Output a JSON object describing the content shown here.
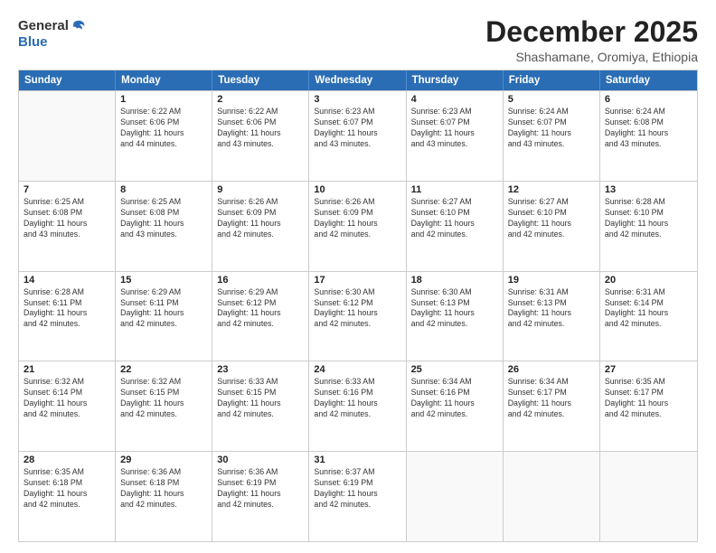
{
  "logo": {
    "general": "General",
    "blue": "Blue"
  },
  "title": "December 2025",
  "subtitle": "Shashamane, Oromiya, Ethiopia",
  "header_days": [
    "Sunday",
    "Monday",
    "Tuesday",
    "Wednesday",
    "Thursday",
    "Friday",
    "Saturday"
  ],
  "weeks": [
    [
      {
        "day": "",
        "info": ""
      },
      {
        "day": "1",
        "info": "Sunrise: 6:22 AM\nSunset: 6:06 PM\nDaylight: 11 hours\nand 44 minutes."
      },
      {
        "day": "2",
        "info": "Sunrise: 6:22 AM\nSunset: 6:06 PM\nDaylight: 11 hours\nand 43 minutes."
      },
      {
        "day": "3",
        "info": "Sunrise: 6:23 AM\nSunset: 6:07 PM\nDaylight: 11 hours\nand 43 minutes."
      },
      {
        "day": "4",
        "info": "Sunrise: 6:23 AM\nSunset: 6:07 PM\nDaylight: 11 hours\nand 43 minutes."
      },
      {
        "day": "5",
        "info": "Sunrise: 6:24 AM\nSunset: 6:07 PM\nDaylight: 11 hours\nand 43 minutes."
      },
      {
        "day": "6",
        "info": "Sunrise: 6:24 AM\nSunset: 6:08 PM\nDaylight: 11 hours\nand 43 minutes."
      }
    ],
    [
      {
        "day": "7",
        "info": "Sunrise: 6:25 AM\nSunset: 6:08 PM\nDaylight: 11 hours\nand 43 minutes."
      },
      {
        "day": "8",
        "info": "Sunrise: 6:25 AM\nSunset: 6:08 PM\nDaylight: 11 hours\nand 43 minutes."
      },
      {
        "day": "9",
        "info": "Sunrise: 6:26 AM\nSunset: 6:09 PM\nDaylight: 11 hours\nand 42 minutes."
      },
      {
        "day": "10",
        "info": "Sunrise: 6:26 AM\nSunset: 6:09 PM\nDaylight: 11 hours\nand 42 minutes."
      },
      {
        "day": "11",
        "info": "Sunrise: 6:27 AM\nSunset: 6:10 PM\nDaylight: 11 hours\nand 42 minutes."
      },
      {
        "day": "12",
        "info": "Sunrise: 6:27 AM\nSunset: 6:10 PM\nDaylight: 11 hours\nand 42 minutes."
      },
      {
        "day": "13",
        "info": "Sunrise: 6:28 AM\nSunset: 6:10 PM\nDaylight: 11 hours\nand 42 minutes."
      }
    ],
    [
      {
        "day": "14",
        "info": "Sunrise: 6:28 AM\nSunset: 6:11 PM\nDaylight: 11 hours\nand 42 minutes."
      },
      {
        "day": "15",
        "info": "Sunrise: 6:29 AM\nSunset: 6:11 PM\nDaylight: 11 hours\nand 42 minutes."
      },
      {
        "day": "16",
        "info": "Sunrise: 6:29 AM\nSunset: 6:12 PM\nDaylight: 11 hours\nand 42 minutes."
      },
      {
        "day": "17",
        "info": "Sunrise: 6:30 AM\nSunset: 6:12 PM\nDaylight: 11 hours\nand 42 minutes."
      },
      {
        "day": "18",
        "info": "Sunrise: 6:30 AM\nSunset: 6:13 PM\nDaylight: 11 hours\nand 42 minutes."
      },
      {
        "day": "19",
        "info": "Sunrise: 6:31 AM\nSunset: 6:13 PM\nDaylight: 11 hours\nand 42 minutes."
      },
      {
        "day": "20",
        "info": "Sunrise: 6:31 AM\nSunset: 6:14 PM\nDaylight: 11 hours\nand 42 minutes."
      }
    ],
    [
      {
        "day": "21",
        "info": "Sunrise: 6:32 AM\nSunset: 6:14 PM\nDaylight: 11 hours\nand 42 minutes."
      },
      {
        "day": "22",
        "info": "Sunrise: 6:32 AM\nSunset: 6:15 PM\nDaylight: 11 hours\nand 42 minutes."
      },
      {
        "day": "23",
        "info": "Sunrise: 6:33 AM\nSunset: 6:15 PM\nDaylight: 11 hours\nand 42 minutes."
      },
      {
        "day": "24",
        "info": "Sunrise: 6:33 AM\nSunset: 6:16 PM\nDaylight: 11 hours\nand 42 minutes."
      },
      {
        "day": "25",
        "info": "Sunrise: 6:34 AM\nSunset: 6:16 PM\nDaylight: 11 hours\nand 42 minutes."
      },
      {
        "day": "26",
        "info": "Sunrise: 6:34 AM\nSunset: 6:17 PM\nDaylight: 11 hours\nand 42 minutes."
      },
      {
        "day": "27",
        "info": "Sunrise: 6:35 AM\nSunset: 6:17 PM\nDaylight: 11 hours\nand 42 minutes."
      }
    ],
    [
      {
        "day": "28",
        "info": "Sunrise: 6:35 AM\nSunset: 6:18 PM\nDaylight: 11 hours\nand 42 minutes."
      },
      {
        "day": "29",
        "info": "Sunrise: 6:36 AM\nSunset: 6:18 PM\nDaylight: 11 hours\nand 42 minutes."
      },
      {
        "day": "30",
        "info": "Sunrise: 6:36 AM\nSunset: 6:19 PM\nDaylight: 11 hours\nand 42 minutes."
      },
      {
        "day": "31",
        "info": "Sunrise: 6:37 AM\nSunset: 6:19 PM\nDaylight: 11 hours\nand 42 minutes."
      },
      {
        "day": "",
        "info": ""
      },
      {
        "day": "",
        "info": ""
      },
      {
        "day": "",
        "info": ""
      }
    ]
  ]
}
